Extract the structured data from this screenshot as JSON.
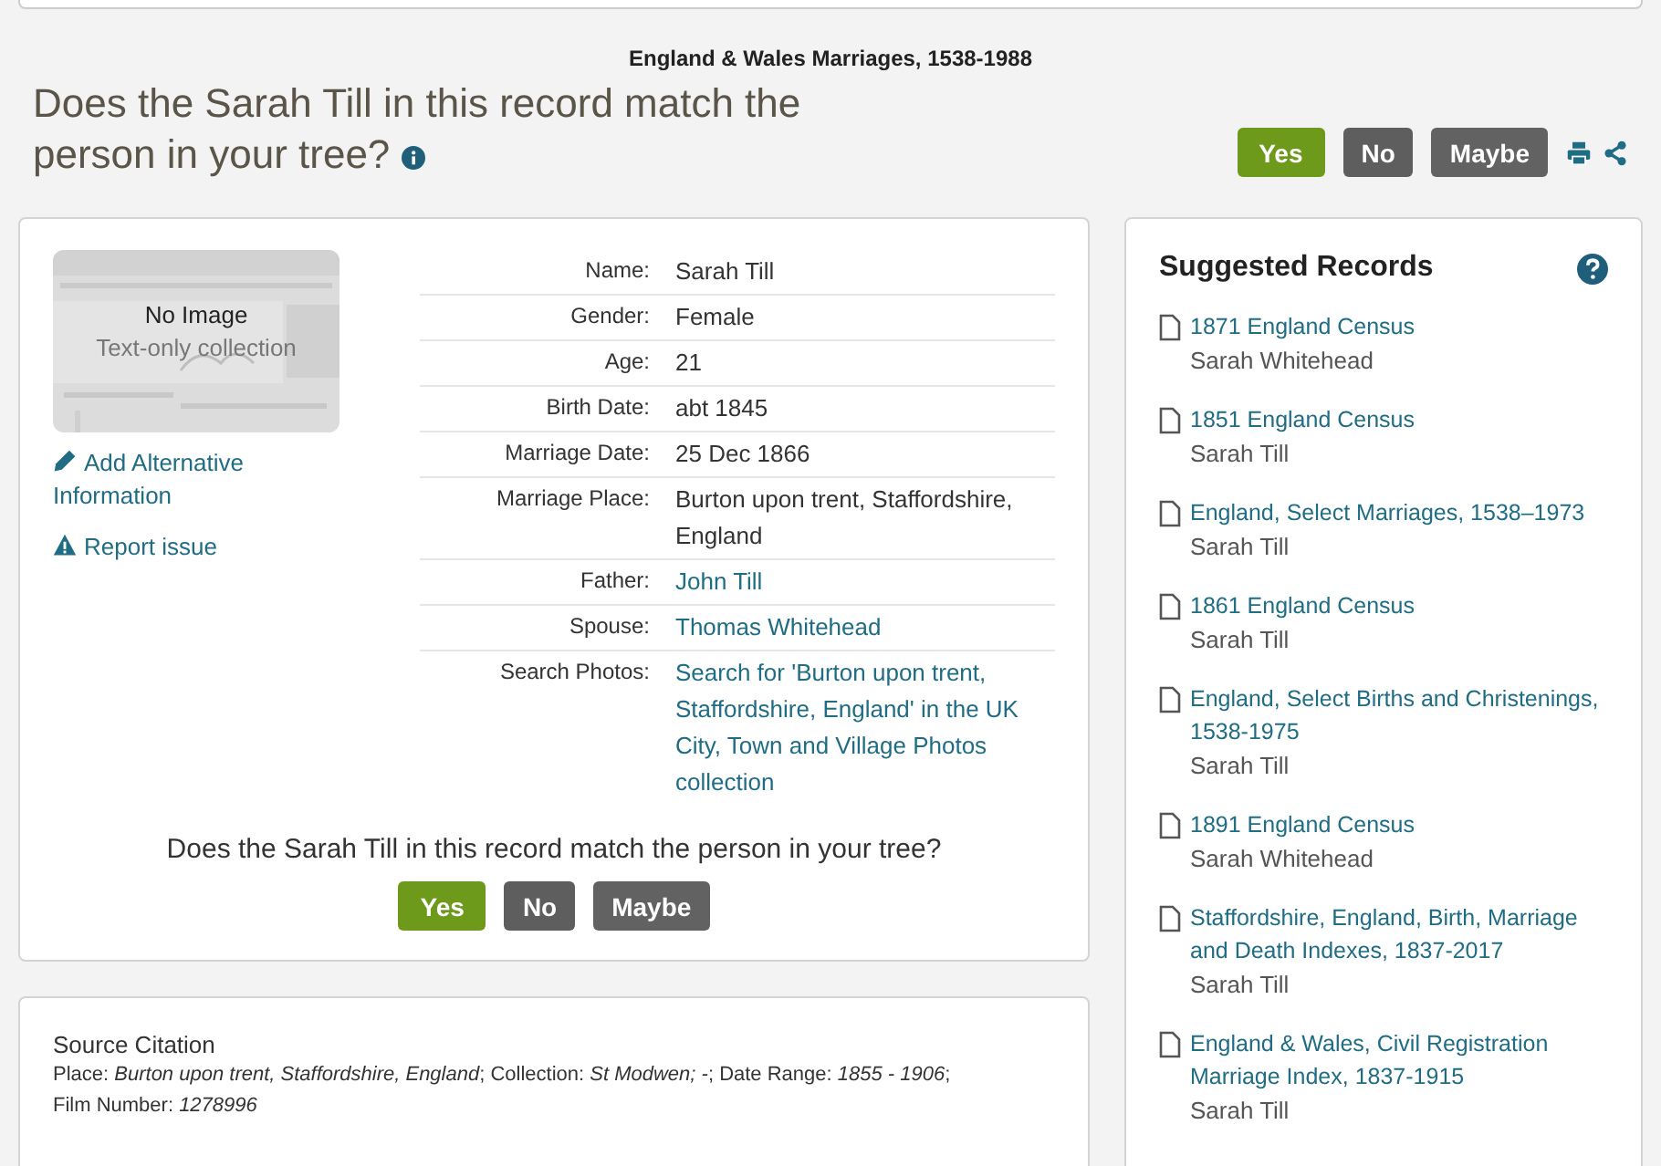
{
  "collection_title": "England & Wales Marriages, 1538-1988",
  "question": "Does the Sarah Till in this record match the person in your tree?",
  "top_buttons": [
    {
      "label": "Yes",
      "kind": "yes"
    },
    {
      "label": "No",
      "kind": "no"
    },
    {
      "label": "Maybe",
      "kind": "maybe"
    }
  ],
  "image": {
    "title": "No Image",
    "subtitle": "Text-only collection"
  },
  "side_links": [
    {
      "label": "Add Alternative Information",
      "kind": "edit"
    },
    {
      "label": "Report issue",
      "kind": "warning"
    }
  ],
  "details": [
    {
      "label": "Name:",
      "value": "Sarah Till",
      "kind": "text"
    },
    {
      "label": "Gender:",
      "value": "Female",
      "kind": "text"
    },
    {
      "label": "Age:",
      "value": "21",
      "kind": "text"
    },
    {
      "label": "Birth Date:",
      "value": "abt 1845",
      "kind": "text"
    },
    {
      "label": "Marriage Date:",
      "value": "25 Dec 1866",
      "kind": "text"
    },
    {
      "label": "Marriage Place:",
      "value": "Burton upon trent, Staffordshire, England",
      "kind": "text"
    },
    {
      "label": "Father:",
      "value": "John Till",
      "kind": "link"
    },
    {
      "label": "Spouse:",
      "value": "Thomas Whitehead",
      "kind": "link"
    },
    {
      "label": "Search Photos:",
      "value": "Search for 'Burton upon trent, Staffordshire, England' in the UK City, Town and Village Photos collection",
      "kind": "link"
    }
  ],
  "bottom_question": "Does the Sarah Till in this record match the person in your tree?",
  "bottom_buttons": [
    {
      "label": "Yes",
      "kind": "yes"
    },
    {
      "label": "No",
      "kind": "no"
    },
    {
      "label": "Maybe",
      "kind": "maybe"
    }
  ],
  "source_citation": {
    "title": "Source Citation",
    "text": "Place: *Burton upon trent, Staffordshire, England*; Collection: *St Modwen; -*; Date Range: *1855 - 1906*; Film Number: *1278996*"
  },
  "suggested_records": {
    "title": "Suggested Records",
    "items": [
      {
        "title": "1871 England Census",
        "person": "Sarah Whitehead"
      },
      {
        "title": "1851 England Census",
        "person": "Sarah Till"
      },
      {
        "title": "England, Select Marriages, 1538–1973",
        "person": "Sarah Till"
      },
      {
        "title": "1861 England Census",
        "person": "Sarah Till"
      },
      {
        "title": "England, Select Births and Christenings, 1538-1975",
        "person": "Sarah Till"
      },
      {
        "title": "1891 England Census",
        "person": "Sarah Whitehead"
      },
      {
        "title": "Staffordshire, England, Birth, Marriage and Death Indexes, 1837-2017",
        "person": "Sarah Till"
      },
      {
        "title": "England & Wales, Civil Registration Marriage Index, 1837-1915",
        "person": "Sarah Till"
      }
    ]
  }
}
